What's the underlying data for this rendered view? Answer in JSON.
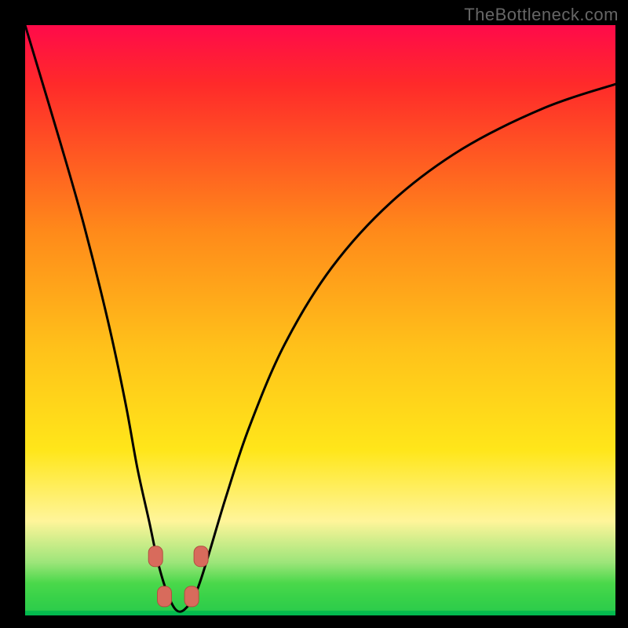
{
  "watermark": "TheBottleneck.com",
  "colors": {
    "black": "#000000",
    "watermark": "#666666",
    "grad_top_red_pink": "#ff0a4a",
    "grad_red": "#ff2a2a",
    "grad_orange": "#ff8a1a",
    "grad_yellow_orange": "#ffc21a",
    "grad_yellow": "#ffe61a",
    "grad_pale_yellow": "#fff59a",
    "grad_light_green": "#9de57a",
    "grad_green_top": "#4bd84b",
    "grad_green_mid": "#22c947",
    "grad_green_bottom": "#00b84f",
    "curve": "#000000",
    "marker_fill": "#d86b5c",
    "marker_stroke": "#b24e40"
  },
  "chart_data": {
    "type": "line",
    "title": "",
    "xlabel": "",
    "ylabel": "",
    "xlim": [
      0,
      100
    ],
    "ylim": [
      0,
      100
    ],
    "note": "Percent-of-plot coordinates. Origin bottom-left. No numeric tick labels are displayed in the original image; values are pixel-proportional estimates.",
    "series": [
      {
        "name": "bottleneck-curve",
        "x": [
          0,
          3,
          6,
          10,
          14,
          17,
          19,
          21,
          22.5,
          24,
          25.5,
          27,
          29,
          31,
          34,
          38,
          44,
          52,
          62,
          74,
          88,
          100
        ],
        "y": [
          100,
          90,
          80,
          66,
          50,
          36,
          25,
          16,
          9,
          4,
          1,
          1,
          4,
          10,
          20,
          32,
          46,
          59,
          70,
          79,
          86,
          90
        ]
      }
    ],
    "markers": [
      {
        "name": "marker-left-upper",
        "x": 22.1,
        "y": 10
      },
      {
        "name": "marker-left-lower",
        "x": 23.6,
        "y": 3.2
      },
      {
        "name": "marker-right-lower",
        "x": 28.2,
        "y": 3.2
      },
      {
        "name": "marker-right-upper",
        "x": 29.8,
        "y": 10
      }
    ],
    "green_band": {
      "y_bottom": 0.8,
      "y_top": 5.5
    }
  }
}
